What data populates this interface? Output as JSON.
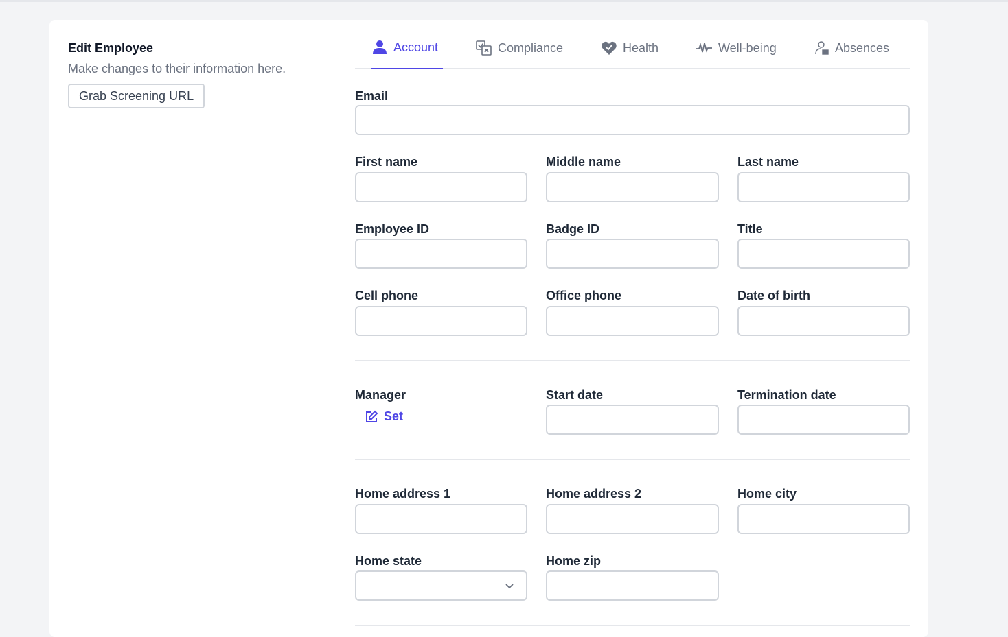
{
  "panel": {
    "title": "Edit Employee",
    "subtitle": "Make changes to their information here.",
    "screening_button": "Grab Screening URL"
  },
  "tabs": [
    {
      "label": "Account",
      "icon": "user-icon",
      "active": true
    },
    {
      "label": "Compliance",
      "icon": "compliance-icon",
      "active": false
    },
    {
      "label": "Health",
      "icon": "heart-icon",
      "active": false
    },
    {
      "label": "Well-being",
      "icon": "pulse-icon",
      "active": false
    },
    {
      "label": "Absences",
      "icon": "absence-person-icon",
      "active": false
    }
  ],
  "fields": {
    "email": {
      "label": "Email",
      "value": ""
    },
    "first_name": {
      "label": "First name",
      "value": ""
    },
    "middle_name": {
      "label": "Middle name",
      "value": ""
    },
    "last_name": {
      "label": "Last name",
      "value": ""
    },
    "employee_id": {
      "label": "Employee ID",
      "value": ""
    },
    "badge_id": {
      "label": "Badge ID",
      "value": ""
    },
    "title": {
      "label": "Title",
      "value": ""
    },
    "cell_phone": {
      "label": "Cell phone",
      "value": ""
    },
    "office_phone": {
      "label": "Office phone",
      "value": ""
    },
    "date_of_birth": {
      "label": "Date of birth",
      "value": ""
    },
    "manager": {
      "label": "Manager",
      "action": "Set"
    },
    "start_date": {
      "label": "Start date",
      "value": ""
    },
    "termination_date": {
      "label": "Termination date",
      "value": ""
    },
    "home_address_1": {
      "label": "Home address 1",
      "value": ""
    },
    "home_address_2": {
      "label": "Home address 2",
      "value": ""
    },
    "home_city": {
      "label": "Home city",
      "value": ""
    },
    "home_state": {
      "label": "Home state",
      "value": ""
    },
    "home_zip": {
      "label": "Home zip",
      "value": ""
    }
  },
  "colors": {
    "accent": "#4f46e5",
    "background": "#f3f4f6",
    "border": "#d1d5db",
    "muted_text": "#6b7280"
  }
}
